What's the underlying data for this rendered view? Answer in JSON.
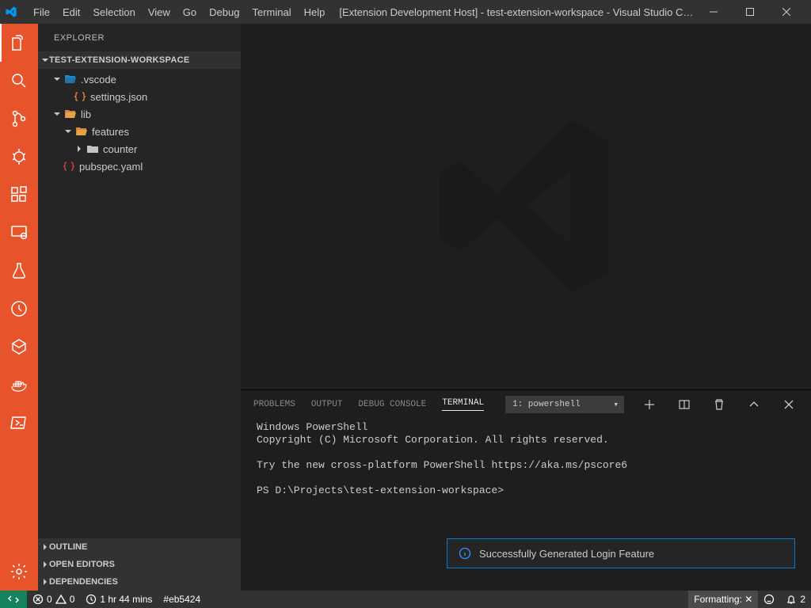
{
  "titlebar": {
    "menus": [
      "File",
      "Edit",
      "Selection",
      "View",
      "Go",
      "Debug",
      "Terminal",
      "Help"
    ],
    "title": "[Extension Development Host] - test-extension-workspace - Visual Studio Code [Admi…"
  },
  "sidebar": {
    "title": "EXPLORER",
    "workspace": "TEST-EXTENSION-WORKSPACE",
    "tree": {
      "vscode": ".vscode",
      "settings": "settings.json",
      "lib": "lib",
      "features": "features",
      "counter": "counter",
      "pubspec": "pubspec.yaml"
    },
    "collapsibles": [
      "OUTLINE",
      "OPEN EDITORS",
      "DEPENDENCIES"
    ]
  },
  "panel": {
    "tabs": [
      "PROBLEMS",
      "OUTPUT",
      "DEBUG CONSOLE",
      "TERMINAL"
    ],
    "active_tab": 3,
    "dropdown": "1: powershell",
    "terminal_lines": [
      "Windows PowerShell",
      "Copyright (C) Microsoft Corporation. All rights reserved.",
      "",
      "Try the new cross-platform PowerShell https://aka.ms/pscore6",
      "",
      "PS D:\\Projects\\test-extension-workspace>"
    ]
  },
  "toast": {
    "text": "Successfully Generated Login Feature"
  },
  "statusbar": {
    "errors": "0",
    "warnings": "0",
    "time": "1 hr 44 mins",
    "git": "#eb5424",
    "formatting": "Formatting: ✕",
    "notifications": "2"
  }
}
